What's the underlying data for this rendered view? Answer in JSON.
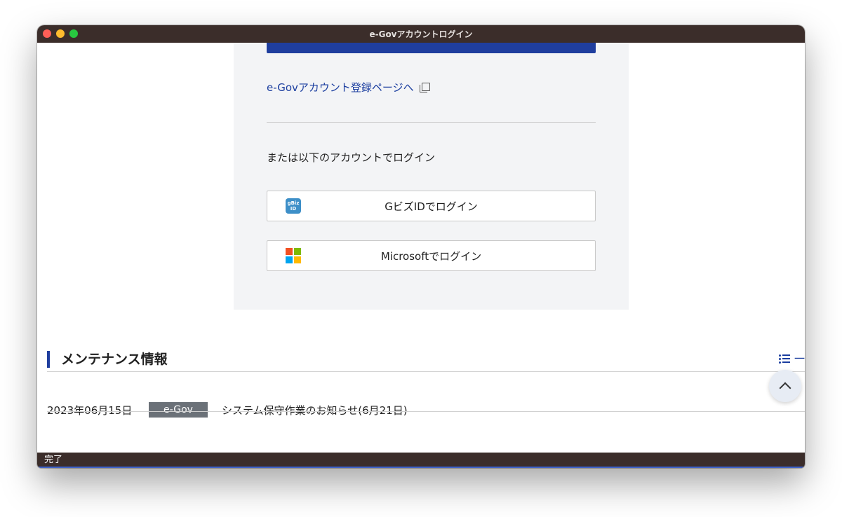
{
  "window": {
    "title": "e-Govアカウントログイン"
  },
  "login": {
    "register_link": "e-Govアカウント登録ページへ",
    "alt_text": "または以下のアカウントでログイン",
    "gbiz_button": "GビズIDでログイン",
    "gbiz_icon_text": [
      "gBiz",
      "ID"
    ],
    "microsoft_button": "Microsoftでログイン"
  },
  "maintenance": {
    "heading": "メンテナンス情報",
    "list_link": "一",
    "items": [
      {
        "date": "2023年06月15日",
        "badge": "e-Gov",
        "title": "システム保守作業のお知らせ(6月21日)"
      }
    ]
  },
  "status": {
    "text": "完了"
  },
  "colors": {
    "primary": "#1f3e9e",
    "link": "#1a3d9f",
    "panel_bg": "#f3f4f6",
    "titlebar": "#3b2d2a",
    "badge": "#6b7178"
  },
  "icons": [
    "external-link-icon",
    "gbiz-id-logo-icon",
    "microsoft-logo-icon",
    "list-icon",
    "chevron-up-icon"
  ]
}
